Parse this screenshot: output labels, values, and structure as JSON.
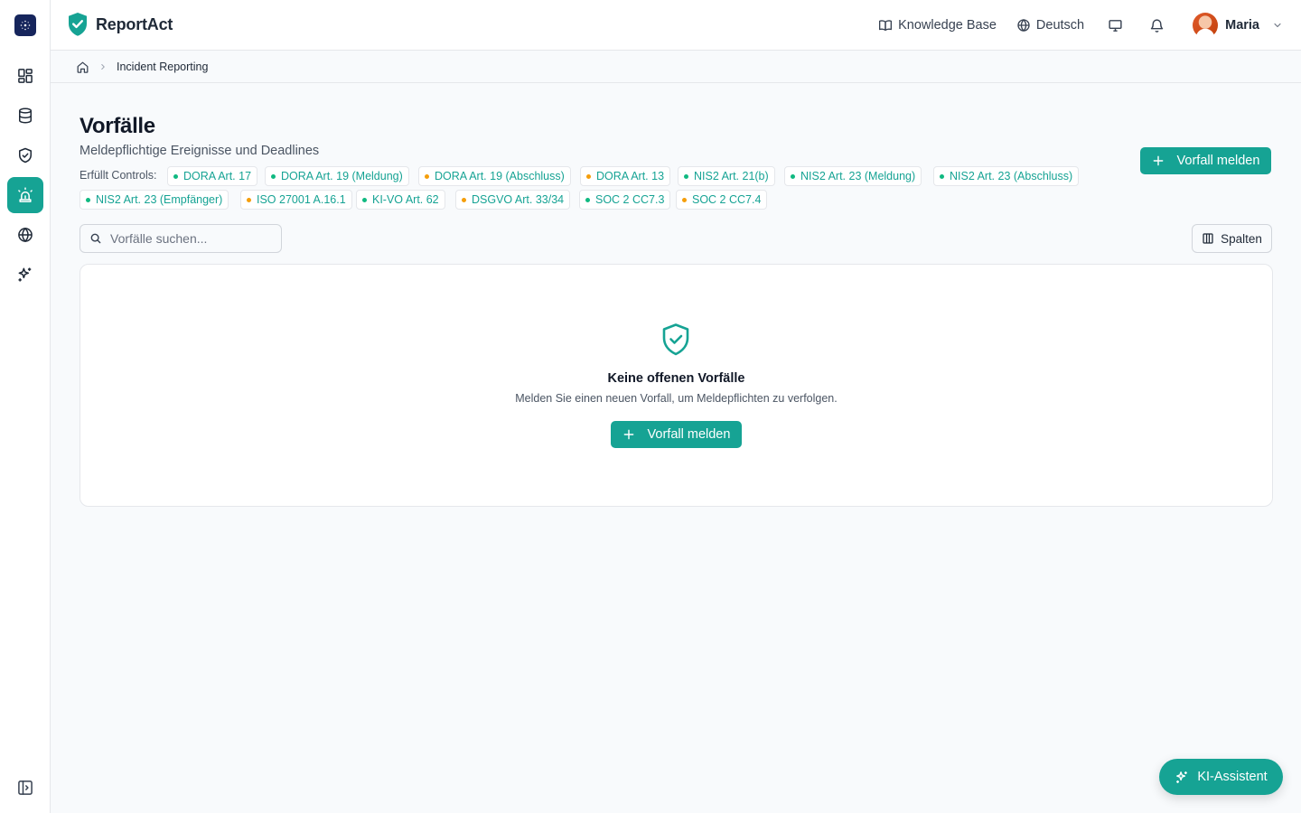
{
  "app": {
    "name": "ReportAct"
  },
  "topbar": {
    "knowledge_base": "Knowledge Base",
    "language": "Deutsch",
    "user_name": "Maria"
  },
  "breadcrumb": {
    "current": "Incident Reporting"
  },
  "page": {
    "title": "Vorfälle",
    "subtitle": "Meldepflichtige Ereignisse und Deadlines",
    "controls_label": "Erfüllt Controls:",
    "report_button": "Vorfall melden"
  },
  "controls": [
    {
      "label": "DORA Art. 17",
      "status": "green"
    },
    {
      "label": "DORA Art. 19 (Meldung)",
      "status": "green"
    },
    {
      "label": "DORA Art. 19 (Abschluss)",
      "status": "orange"
    },
    {
      "label": "DORA Art. 13",
      "status": "orange"
    },
    {
      "label": "NIS2 Art. 21(b)",
      "status": "green"
    },
    {
      "label": "NIS2 Art. 23 (Meldung)",
      "status": "green"
    },
    {
      "label": "NIS2 Art. 23 (Abschluss)",
      "status": "green"
    },
    {
      "label": "NIS2 Art. 23 (Empfänger)",
      "status": "green"
    },
    {
      "label": "ISO 27001 A.16.1",
      "status": "orange"
    },
    {
      "label": "KI-VO Art. 62",
      "status": "green"
    },
    {
      "label": "DSGVO Art. 33/34",
      "status": "orange"
    },
    {
      "label": "SOC 2 CC7.3",
      "status": "green"
    },
    {
      "label": "SOC 2 CC7.4",
      "status": "orange"
    }
  ],
  "search": {
    "placeholder": "Vorfälle suchen..."
  },
  "columns_button": "Spalten",
  "empty_state": {
    "title": "Keine offenen Vorfälle",
    "text": "Melden Sie einen neuen Vorfall, um Meldepflichten zu verfolgen.",
    "button": "Vorfall melden"
  },
  "assistant_button": "KI-Assistent",
  "colors": {
    "accent": "#16a394",
    "status_green": "#10b981",
    "status_orange": "#f59e0b",
    "rail_logo": "#16255c"
  },
  "nav_icons": [
    "dashboard-icon",
    "database-icon",
    "shield-check-icon",
    "siren-icon",
    "globe-icon",
    "sparkles-icon"
  ]
}
